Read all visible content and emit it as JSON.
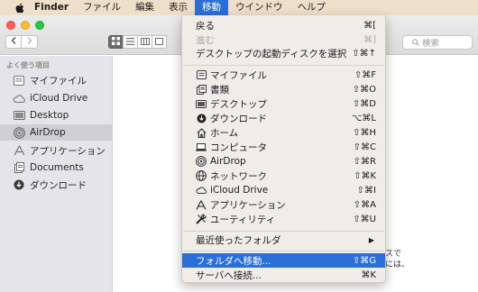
{
  "menubar": {
    "app_name": "Finder",
    "items": [
      "ファイル",
      "編集",
      "表示",
      "移動",
      "ウインドウ",
      "ヘルプ"
    ],
    "active_item": "移動"
  },
  "search": {
    "placeholder": "検索"
  },
  "sidebar": {
    "heading": "よく使う項目",
    "items": [
      {
        "label": "マイファイル",
        "icon": "all-my-files-icon"
      },
      {
        "label": "iCloud Drive",
        "icon": "cloud-icon"
      },
      {
        "label": "Desktop",
        "icon": "desktop-icon"
      },
      {
        "label": "AirDrop",
        "icon": "airdrop-icon",
        "selected": true
      },
      {
        "label": "アプリケーション",
        "icon": "applications-icon"
      },
      {
        "label": "Documents",
        "icon": "documents-icon"
      },
      {
        "label": "ダウンロード",
        "icon": "downloads-icon"
      }
    ]
  },
  "airdrop_hint": {
    "line1": "スで",
    "line2": "には、"
  },
  "go_menu": {
    "back": {
      "label": "戻る",
      "shortcut": "⌘["
    },
    "forward": {
      "label": "進む",
      "shortcut": "⌘]"
    },
    "startup_disk": {
      "label": "デスクトップの起動ディスクを選択",
      "shortcut": "⇧⌘↑"
    },
    "places": [
      {
        "label": "マイファイル",
        "shortcut": "⇧⌘F",
        "icon": "all-my-files-icon"
      },
      {
        "label": "書類",
        "shortcut": "⇧⌘O",
        "icon": "documents-icon"
      },
      {
        "label": "デスクトップ",
        "shortcut": "⇧⌘D",
        "icon": "desktop-icon"
      },
      {
        "label": "ダウンロード",
        "shortcut": "⌥⌘L",
        "icon": "downloads-icon"
      },
      {
        "label": "ホーム",
        "shortcut": "⇧⌘H",
        "icon": "home-icon"
      },
      {
        "label": "コンピュータ",
        "shortcut": "⇧⌘C",
        "icon": "computer-icon"
      },
      {
        "label": "AirDrop",
        "shortcut": "⇧⌘R",
        "icon": "airdrop-icon"
      },
      {
        "label": "ネットワーク",
        "shortcut": "⇧⌘K",
        "icon": "network-icon"
      },
      {
        "label": "iCloud Drive",
        "shortcut": "⇧⌘I",
        "icon": "cloud-icon"
      },
      {
        "label": "アプリケーション",
        "shortcut": "⇧⌘A",
        "icon": "applications-icon"
      },
      {
        "label": "ユーティリティ",
        "shortcut": "⇧⌘U",
        "icon": "utilities-icon"
      }
    ],
    "recent_folders": {
      "label": "最近使ったフォルダ",
      "submenu_indicator": "▶"
    },
    "go_to_folder": {
      "label": "フォルダへ移動...",
      "shortcut": "⇧⌘G"
    },
    "connect_server": {
      "label": "サーバへ接続...",
      "shortcut": "⌘K"
    }
  },
  "colors": {
    "menu_highlight": "#2b6fd6",
    "menubar_bg": "#eedfc8",
    "sidebar_bg": "#e5e5e7"
  }
}
